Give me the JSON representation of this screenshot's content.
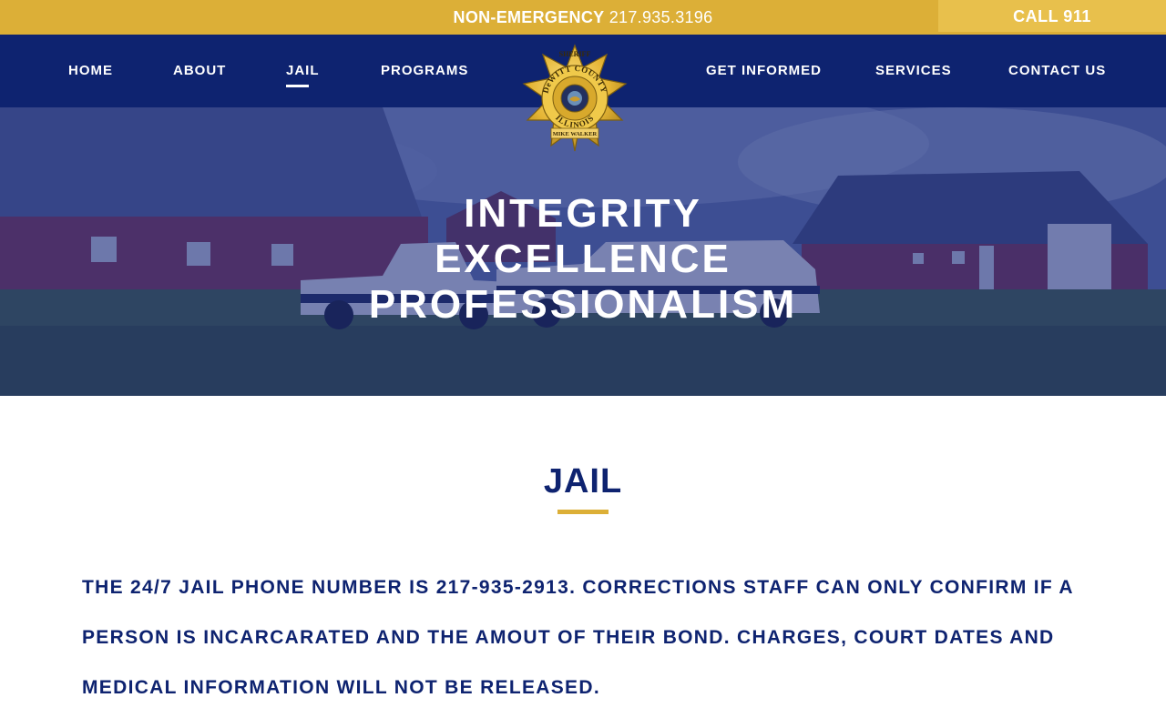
{
  "topbar": {
    "non_emergency_label": "NON-EMERGENCY",
    "non_emergency_number": "217.935.3196",
    "call_label": "CALL 911"
  },
  "nav": {
    "left": [
      {
        "label": "HOME",
        "active": false
      },
      {
        "label": "ABOUT",
        "active": false
      },
      {
        "label": "JAIL",
        "active": true
      },
      {
        "label": "PROGRAMS",
        "active": false
      }
    ],
    "right": [
      {
        "label": "GET INFORMED",
        "active": false
      },
      {
        "label": "SERVICES",
        "active": false
      },
      {
        "label": "CONTACT US",
        "active": false
      }
    ]
  },
  "badge": {
    "top": "SHERIFF",
    "county": "DeWITT COUNTY",
    "state": "ILLINOIS",
    "name": "MIKE WALKER"
  },
  "hero": {
    "motto": [
      "INTEGRITY",
      "EXCELLENCE",
      "PROFESSIONALISM"
    ]
  },
  "main": {
    "title": "JAIL",
    "body": "THE 24/7 JAIL PHONE NUMBER IS 217-935-2913.  CORRECTIONS STAFF CAN ONLY CONFIRM IF A PERSON IS INCARCARATED AND THE AMOUT OF THEIR BOND.  CHARGES, COURT DATES AND MEDICAL INFORMATION WILL NOT BE RELEASED."
  },
  "colors": {
    "navy": "#0e2370",
    "gold": "#dcaf37",
    "gold_light": "#e8c04c",
    "white": "#ffffff"
  }
}
